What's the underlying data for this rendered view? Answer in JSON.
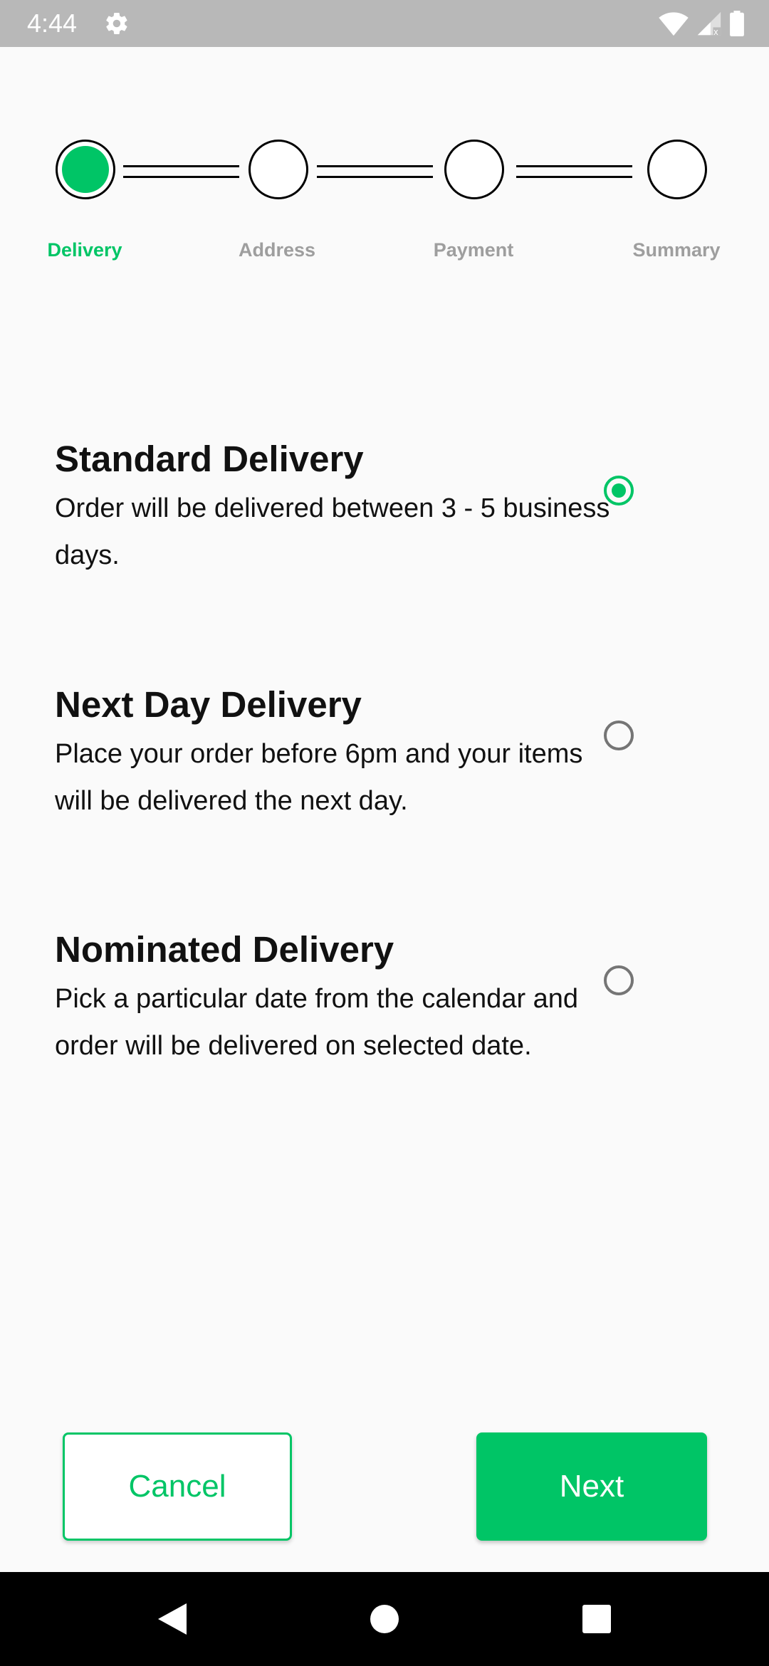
{
  "status_bar": {
    "time": "4:44",
    "icons": [
      "settings-gear-icon",
      "wifi-icon",
      "cellular-signal-icon",
      "battery-icon"
    ]
  },
  "stepper": {
    "steps": [
      {
        "label": "Delivery",
        "active": true
      },
      {
        "label": "Address",
        "active": false
      },
      {
        "label": "Payment",
        "active": false
      },
      {
        "label": "Summary",
        "active": false
      }
    ]
  },
  "options": [
    {
      "title": "Standard Delivery",
      "description": "Order will be delivered between 3 - 5 business days.",
      "selected": true
    },
    {
      "title": "Next Day Delivery",
      "description": "Place your order before 6pm and your items will be delivered the next day.",
      "selected": false
    },
    {
      "title": "Nominated Delivery",
      "description": "Pick a particular date from the calendar and order will be delivered on selected date.",
      "selected": false
    }
  ],
  "buttons": {
    "cancel": "Cancel",
    "next": "Next"
  },
  "nav_bar": {
    "icons": [
      "back-triangle-icon",
      "home-circle-icon",
      "recents-square-icon"
    ]
  },
  "colors": {
    "accent": "#00c566",
    "inactive_label": "#9e9e9e",
    "status_bar": "#b8b8b8",
    "background": "#fafafa"
  }
}
